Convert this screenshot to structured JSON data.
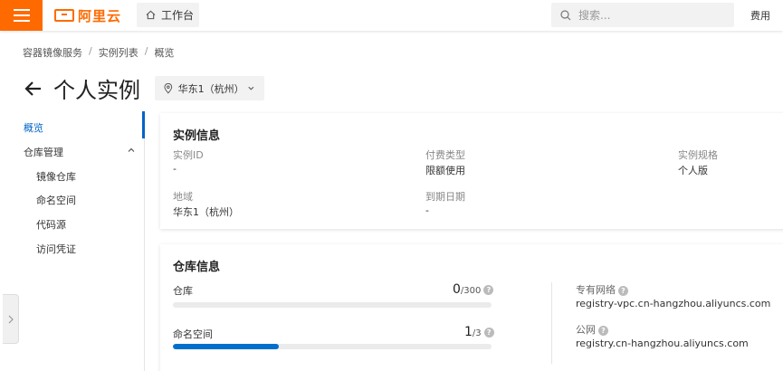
{
  "topbar": {
    "logo_text": "阿里云",
    "workbench_label": "工作台",
    "search_placeholder": "搜索...",
    "fee_label": "费用"
  },
  "breadcrumb": [
    "容器镜像服务",
    "实例列表",
    "概览"
  ],
  "page": {
    "title": "个人实例",
    "region": "华东1（杭州）"
  },
  "sidebar": {
    "active": "概览",
    "group": "仓库管理",
    "items": [
      "镜像仓库",
      "命名空间",
      "代码源",
      "访问凭证"
    ]
  },
  "instance_info": {
    "title": "实例信息",
    "fields": [
      {
        "label": "实例ID",
        "value": "-"
      },
      {
        "label": "付费类型",
        "value": "限额使用"
      },
      {
        "label": "实例规格",
        "value": "个人版"
      },
      {
        "label": "地域",
        "value": "华东1（杭州）"
      },
      {
        "label": "到期日期",
        "value": "-"
      }
    ]
  },
  "repo_info": {
    "title": "仓库信息",
    "stats": [
      {
        "label": "仓库",
        "used": "0",
        "limit": "/300",
        "fraction": 0.0
      },
      {
        "label": "命名空间",
        "used": "1",
        "limit": "/3",
        "fraction": 0.333
      }
    ],
    "network": [
      {
        "label": "专有网络",
        "value": "registry-vpc.cn-hangzhou.aliyuncs.com"
      },
      {
        "label": "公网",
        "value": "registry.cn-hangzhou.aliyuncs.com"
      }
    ]
  },
  "colors": {
    "brand": "#ff6a00",
    "accent": "#0064c8",
    "progress": "#0070cc"
  }
}
